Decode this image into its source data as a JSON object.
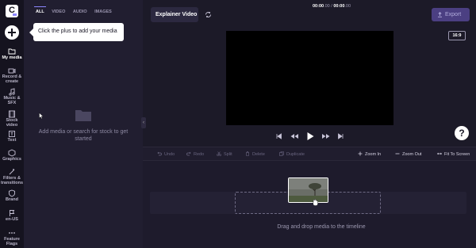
{
  "rail": {
    "logo_letter": "C",
    "items": [
      {
        "label": "My media",
        "icon": "folder-icon"
      },
      {
        "label": "Record &\ncreate",
        "icon": "camera-icon"
      },
      {
        "label": "Music &\nSFX",
        "icon": "music-icon"
      },
      {
        "label": "Stock video",
        "icon": "film-icon"
      },
      {
        "label": "Text",
        "icon": "text-icon"
      },
      {
        "label": "Graphics",
        "icon": "shapes-icon"
      },
      {
        "label": "Filters &\ntransitions",
        "icon": "wand-icon"
      },
      {
        "label": "Brand",
        "icon": "shield-icon"
      },
      {
        "label": "en-US",
        "icon": "flag-icon"
      },
      {
        "label": "Feature\nFlags",
        "icon": "more-icon"
      }
    ]
  },
  "tooltip": {
    "text": "Click the plus to add your media"
  },
  "media": {
    "tabs": [
      "ALL",
      "VIDEO",
      "AUDIO",
      "IMAGES"
    ],
    "active_tab": "ALL",
    "empty_text": "Add media or search for stock to get started"
  },
  "header": {
    "project_title": "Explainer Video",
    "export_label": "Export",
    "aspect_ratio": "16:9"
  },
  "help": {
    "label": "?"
  },
  "toolbar": {
    "undo": "Undo",
    "redo": "Redo",
    "split": "Split",
    "delete": "Delete",
    "duplicate": "Duplicate",
    "time_current": "00:00",
    "time_current_frac": ".00",
    "time_sep": " / ",
    "time_total": "00:00",
    "time_total_frac": ".00",
    "zoom_in": "Zoom In",
    "zoom_out": "Zoom Out",
    "fit": "Fit To Screen"
  },
  "timeline": {
    "drop_text": "Drag and drop media to the timeline"
  },
  "colors": {
    "accent": "#8d86ff",
    "export_bg": "#4b3f82",
    "background": "#1f1c2e"
  }
}
